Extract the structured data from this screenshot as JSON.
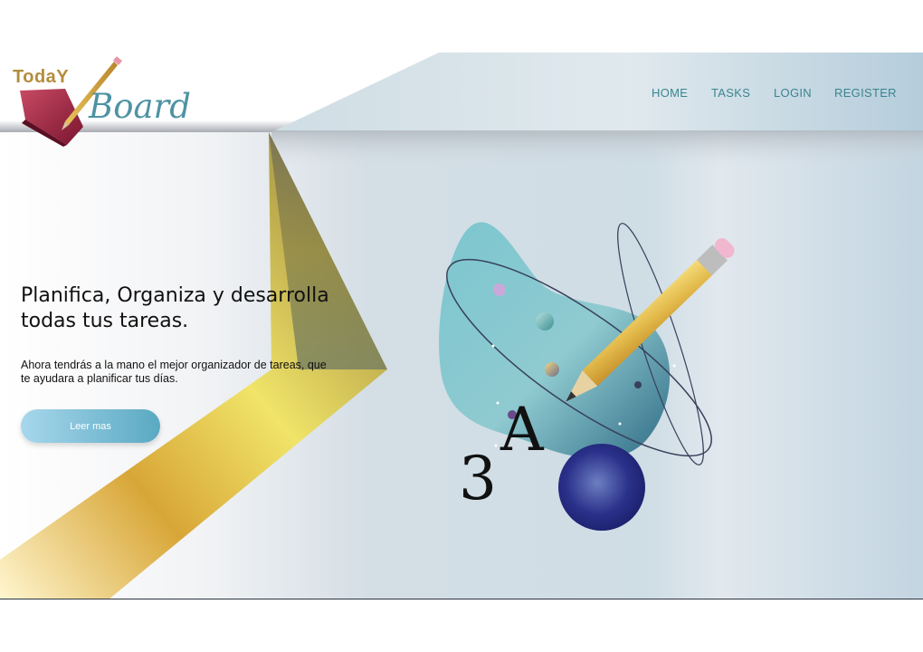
{
  "brand": {
    "today": "TodaY",
    "board": "Board",
    "colors": {
      "today": "#b48d3b",
      "board": "#4e93a3",
      "book": "#9e1f3d"
    }
  },
  "nav": {
    "items": [
      {
        "label": "HOME"
      },
      {
        "label": "TASKS"
      },
      {
        "label": "LOGIN"
      },
      {
        "label": "REGISTER"
      }
    ],
    "color": "#3a8590"
  },
  "hero": {
    "title_line1": "Planifica, Organiza y desarrolla",
    "title_line2": "todas tus tareas.",
    "subtitle": "Ahora tendrás a la mano el mejor organizador de tareas, que te ayudara a planificar tus días.",
    "cta_label": "Leer mas",
    "cta_colors": {
      "from": "#a7d7ec",
      "to": "#5aa9c2",
      "text": "#ffffff"
    }
  },
  "illustration": {
    "letter_a": "A",
    "digit_3": "3",
    "icons": [
      "blob-icon",
      "pencil-icon",
      "planet-icon",
      "orbit-icon"
    ]
  }
}
